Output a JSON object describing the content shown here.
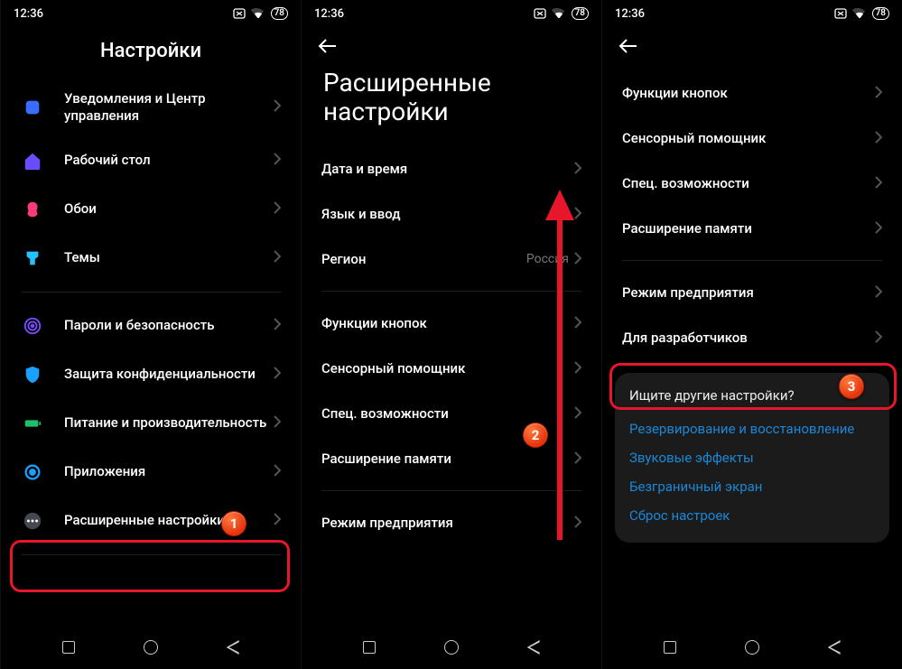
{
  "status": {
    "time": "12:36",
    "battery": "78"
  },
  "badges": {
    "b1": "1",
    "b2": "2",
    "b3": "3"
  },
  "panel1": {
    "title": "Настройки",
    "items": [
      {
        "label": "Уведомления и Центр управления"
      },
      {
        "label": "Рабочий стол"
      },
      {
        "label": "Обои"
      },
      {
        "label": "Темы"
      }
    ],
    "items2": [
      {
        "label": "Пароли и безопасность"
      },
      {
        "label": "Защита конфиденциальности"
      },
      {
        "label": "Питание и производительность"
      },
      {
        "label": "Приложения"
      },
      {
        "label": "Расширенные настройки"
      }
    ]
  },
  "panel2": {
    "title": "Расширенные настройки",
    "itemsA": [
      {
        "label": "Дата и время"
      },
      {
        "label": "Язык и ввод"
      },
      {
        "label": "Регион",
        "value": "Россия"
      }
    ],
    "itemsB": [
      {
        "label": "Функции кнопок"
      },
      {
        "label": "Сенсорный помощник"
      },
      {
        "label": "Спец. возможности"
      },
      {
        "label": "Расширение памяти"
      }
    ],
    "itemsC": [
      {
        "label": "Режим предприятия"
      }
    ]
  },
  "panel3": {
    "itemsA": [
      {
        "label": "Функции кнопок"
      },
      {
        "label": "Сенсорный помощник"
      },
      {
        "label": "Спец. возможности"
      },
      {
        "label": "Расширение памяти"
      }
    ],
    "itemsB": [
      {
        "label": "Режим предприятия"
      },
      {
        "label": "Для разработчиков"
      }
    ],
    "card": {
      "title": "Ищите другие настройки?",
      "links": [
        "Резервирование и восстановление",
        "Звуковые эффекты",
        "Безграничный экран",
        "Сброс настроек"
      ]
    }
  }
}
